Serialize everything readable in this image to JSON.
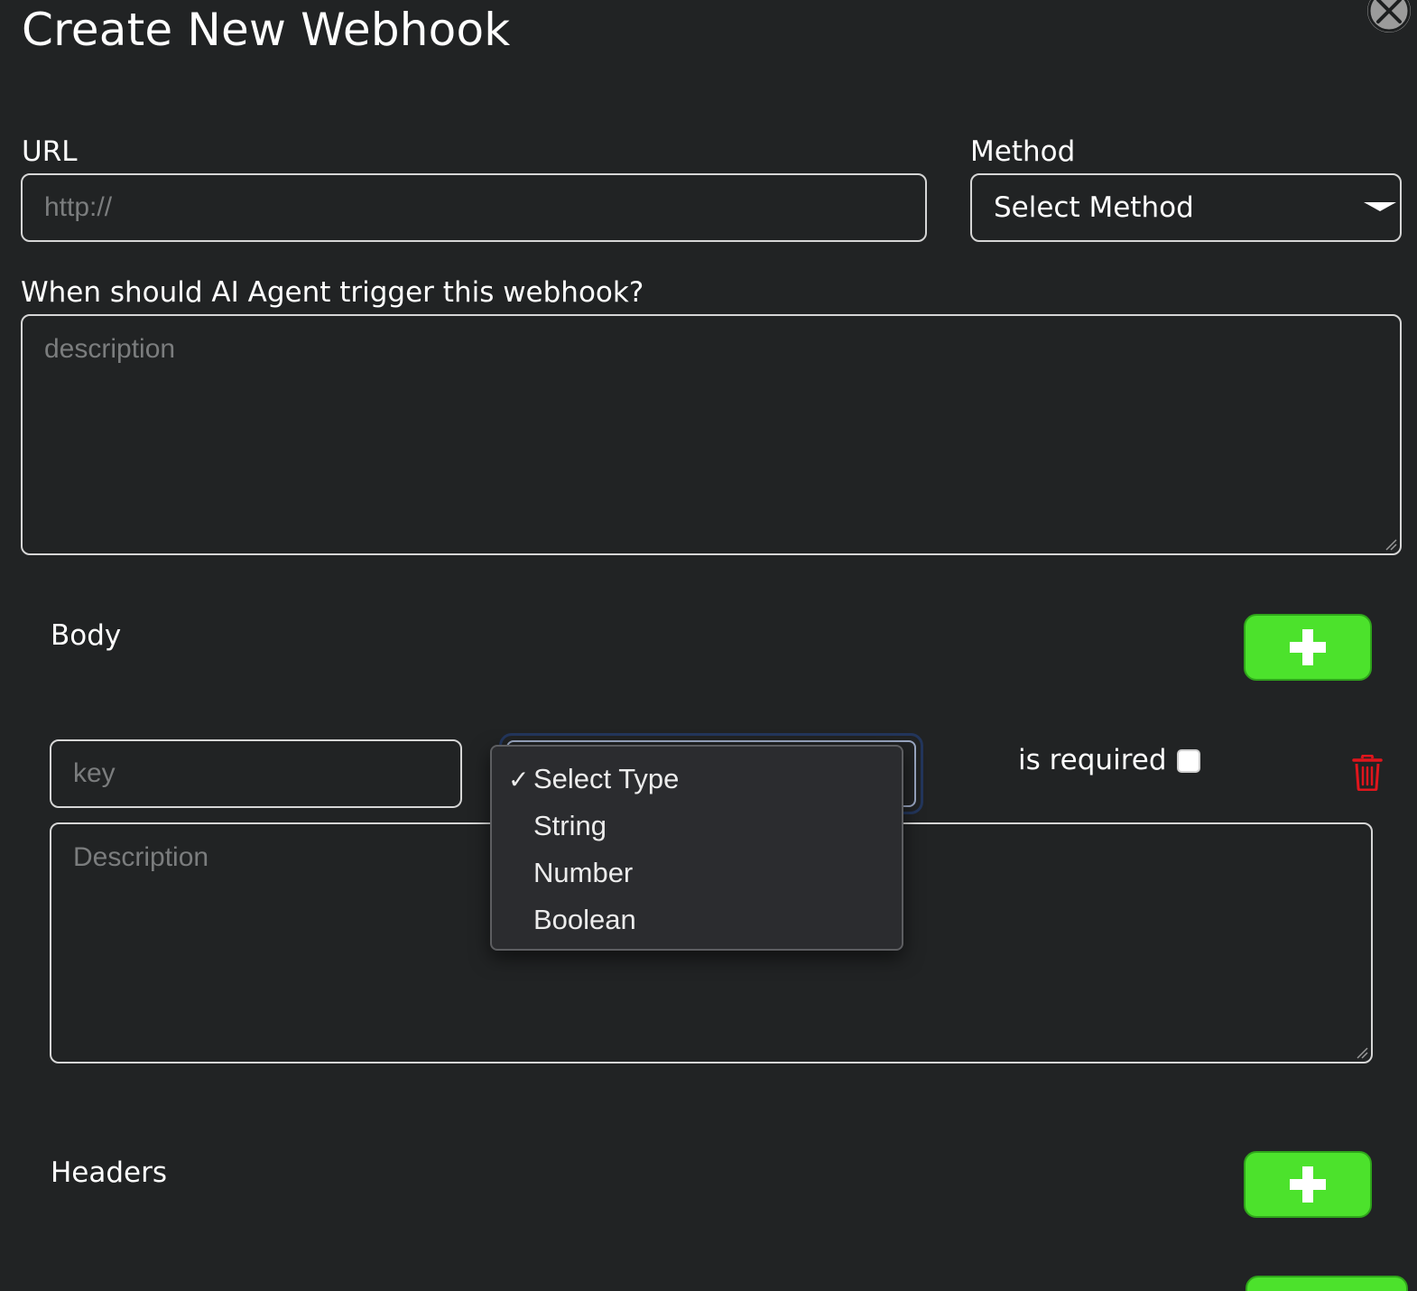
{
  "dialog": {
    "title": "Create New Webhook"
  },
  "url": {
    "label": "URL",
    "placeholder": "http://",
    "value": ""
  },
  "method": {
    "label": "Method",
    "selected": "Select Method"
  },
  "trigger": {
    "label": "When should AI Agent trigger this webhook?",
    "placeholder": "description"
  },
  "body": {
    "section_label": "Body",
    "row": {
      "key_placeholder": "key",
      "description_placeholder": "Description",
      "is_required_label": "is required",
      "is_required_checked": false,
      "type_dropdown": {
        "open": true,
        "selected": "Select Type",
        "check_mark": "✓",
        "options": [
          "Select Type",
          "String",
          "Number",
          "Boolean"
        ]
      }
    }
  },
  "headers": {
    "section_label": "Headers"
  },
  "colors": {
    "background": "#212324",
    "accent_green": "#4ce22c",
    "delete_red": "#e0151c",
    "border": "#d6d6d6"
  },
  "icons": {
    "close": "close-icon",
    "add": "plus-icon",
    "delete": "trash-icon",
    "caret": "chevron-down-icon",
    "check": "checkmark-icon"
  }
}
